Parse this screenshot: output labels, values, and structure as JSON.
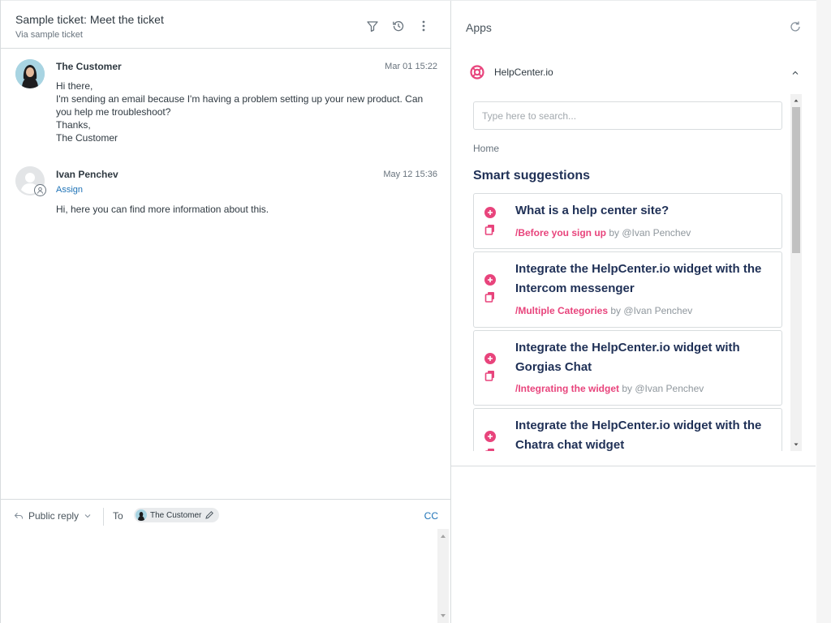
{
  "ticket": {
    "title": "Sample ticket: Meet the ticket",
    "subtitle": "Via sample ticket"
  },
  "messages": [
    {
      "author": "The Customer",
      "time": "Mar 01 15:22",
      "lines": [
        "Hi there,",
        "I'm sending an email because I'm having a problem setting up your new product. Can you help me troubleshoot?",
        "Thanks,",
        "The Customer"
      ]
    },
    {
      "author": "Ivan Penchev",
      "time": "May 12 15:36",
      "assign_label": "Assign",
      "lines": [
        "Hi, here you can find more information about this."
      ]
    }
  ],
  "reply": {
    "mode_label": "Public reply",
    "to_label": "To",
    "recipient": "The Customer",
    "cc_label": "CC"
  },
  "apps": {
    "title": "Apps",
    "app_name": "HelpCenter.io",
    "search_placeholder": "Type here to search...",
    "home_label": "Home",
    "smart_label": "Smart suggestions",
    "articles": [
      {
        "title": "What is a help center site?",
        "category": "/Before you sign up",
        "by": "by @Ivan Penchev"
      },
      {
        "title": "Integrate the HelpCenter.io widget with the Intercom messenger",
        "category": "/Multiple Categories",
        "by": "by @Ivan Penchev"
      },
      {
        "title": "Integrate the HelpCenter.io widget with Gorgias Chat",
        "category": "/Integrating the widget",
        "by": "by @Ivan Penchev"
      },
      {
        "title": "Integrate the HelpCenter.io widget with the Chatra chat widget",
        "category": "",
        "by": ""
      }
    ]
  },
  "colors": {
    "accent": "#e8447c",
    "link": "#1f73b7",
    "heading": "#1f3056"
  }
}
